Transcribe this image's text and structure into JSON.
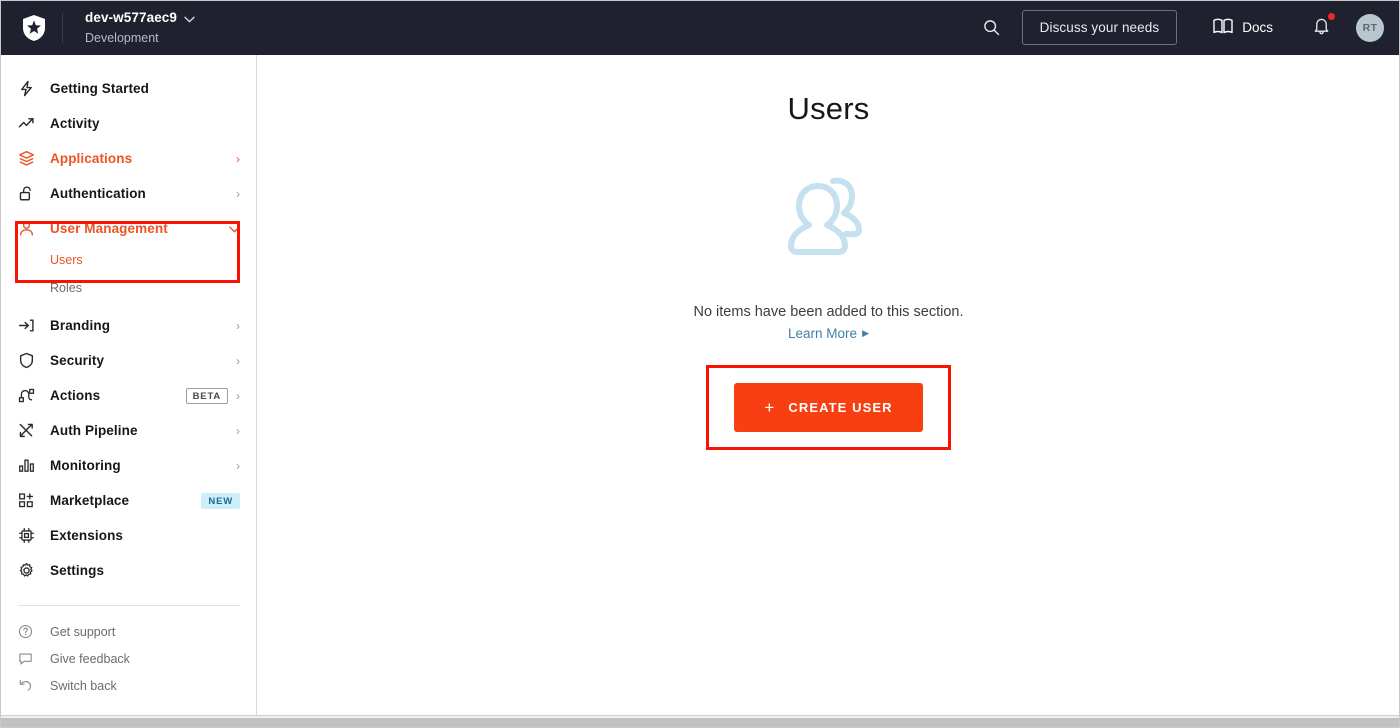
{
  "topbar": {
    "logo_icon": "auth0-shield-logo",
    "tenant_name": "dev-w577aec9",
    "tenant_env": "Development",
    "tenant_chevron": "chevron-down-icon",
    "search_icon": "search-icon",
    "discuss_label": "Discuss your needs",
    "docs_icon": "book-icon",
    "docs_label": "Docs",
    "bell_icon": "bell-icon",
    "bell_has_notification": true,
    "avatar_initials": "RT"
  },
  "sidebar": {
    "items": [
      {
        "label": "Getting Started",
        "icon": "lightning-bolt-icon",
        "chevron": "",
        "badge": "",
        "active": false
      },
      {
        "label": "Activity",
        "icon": "trend-up-icon",
        "chevron": "",
        "badge": "",
        "active": false
      },
      {
        "label": "Applications",
        "icon": "layers-icon",
        "chevron": "›",
        "badge": "",
        "active": true
      },
      {
        "label": "Authentication",
        "icon": "unlock-icon",
        "chevron": "›",
        "badge": "",
        "active": false
      },
      {
        "label": "User Management",
        "icon": "person-icon",
        "chevron": "ˇ",
        "badge": "",
        "active": true
      },
      {
        "label": "Branding",
        "icon": "arrow-into-bracket-icon",
        "chevron": "›",
        "badge": "",
        "active": false
      },
      {
        "label": "Security",
        "icon": "shield-icon",
        "chevron": "›",
        "badge": "",
        "active": false
      },
      {
        "label": "Actions",
        "icon": "actions-node-icon",
        "chevron": "›",
        "badge": "BETA",
        "active": false
      },
      {
        "label": "Auth Pipeline",
        "icon": "crossing-arrows-icon",
        "chevron": "›",
        "badge": "",
        "active": false
      },
      {
        "label": "Monitoring",
        "icon": "bar-chart-icon",
        "chevron": "›",
        "badge": "",
        "active": false
      },
      {
        "label": "Marketplace",
        "icon": "grid-plus-icon",
        "chevron": "",
        "badge": "NEW",
        "active": false
      },
      {
        "label": "Extensions",
        "icon": "chip-icon",
        "chevron": "",
        "badge": "",
        "active": false
      },
      {
        "label": "Settings",
        "icon": "gear-icon",
        "chevron": "",
        "badge": "",
        "active": false
      }
    ],
    "sub_items": [
      {
        "label": "Users",
        "active": true
      },
      {
        "label": "Roles",
        "active": false
      }
    ],
    "footer_items": [
      {
        "label": "Get support",
        "icon": "question-circle-icon"
      },
      {
        "label": "Give feedback",
        "icon": "speech-bubble-icon"
      },
      {
        "label": "Switch back",
        "icon": "undo-arrow-icon"
      }
    ]
  },
  "main": {
    "page_title": "Users",
    "illustration_icon": "two-users-illustration",
    "empty_message": "No items have been added to this section.",
    "learn_more_label": "Learn More",
    "learn_more_arrow": "▶",
    "create_button_plus": "+",
    "create_button_label": "CREATE USER"
  },
  "colors": {
    "topbar_bg": "#20212e",
    "accent_orange": "#eb5424",
    "cta_orange": "#f83f12",
    "annotation_red": "#fb1302",
    "link_blue": "#3f80a8",
    "badge_new_bg": "#cfeefb",
    "badge_new_text": "#1c6a93",
    "illustration_blue": "#c5e0ef",
    "avatar_bg": "#b8c6cd"
  }
}
